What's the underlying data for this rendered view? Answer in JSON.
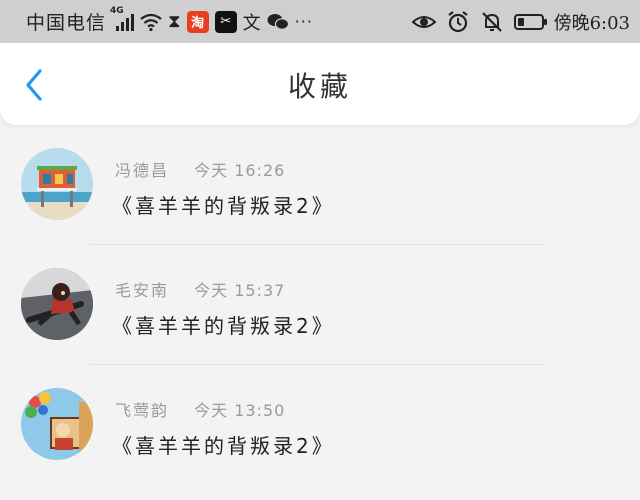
{
  "status_bar": {
    "carrier": "中国电信",
    "network_type": "4G",
    "taobao_label": "淘",
    "capcut_label": "✂",
    "wen_label": "文",
    "more_label": "···",
    "clock": "傍晚6:03"
  },
  "header": {
    "title": "收藏"
  },
  "favorites": [
    {
      "author": "冯德昌",
      "time": "今天 16:26",
      "title": "《喜羊羊的背叛录2》",
      "avatar": "beach-lifeguard-tower"
    },
    {
      "author": "毛安南",
      "time": "今天 15:37",
      "title": "《喜羊羊的背叛录2》",
      "avatar": "anime-character-dark"
    },
    {
      "author": "飞莺韵",
      "time": "今天 13:50",
      "title": "《喜羊羊的背叛录2》",
      "avatar": "cartoon-balloons"
    }
  ],
  "colors": {
    "status_bar_bg": "#cfcfcf",
    "page_bg": "#f3f3f3",
    "header_bg": "#ffffff",
    "accent_back": "#1e9bf0",
    "meta_text": "#9a9a9a"
  }
}
